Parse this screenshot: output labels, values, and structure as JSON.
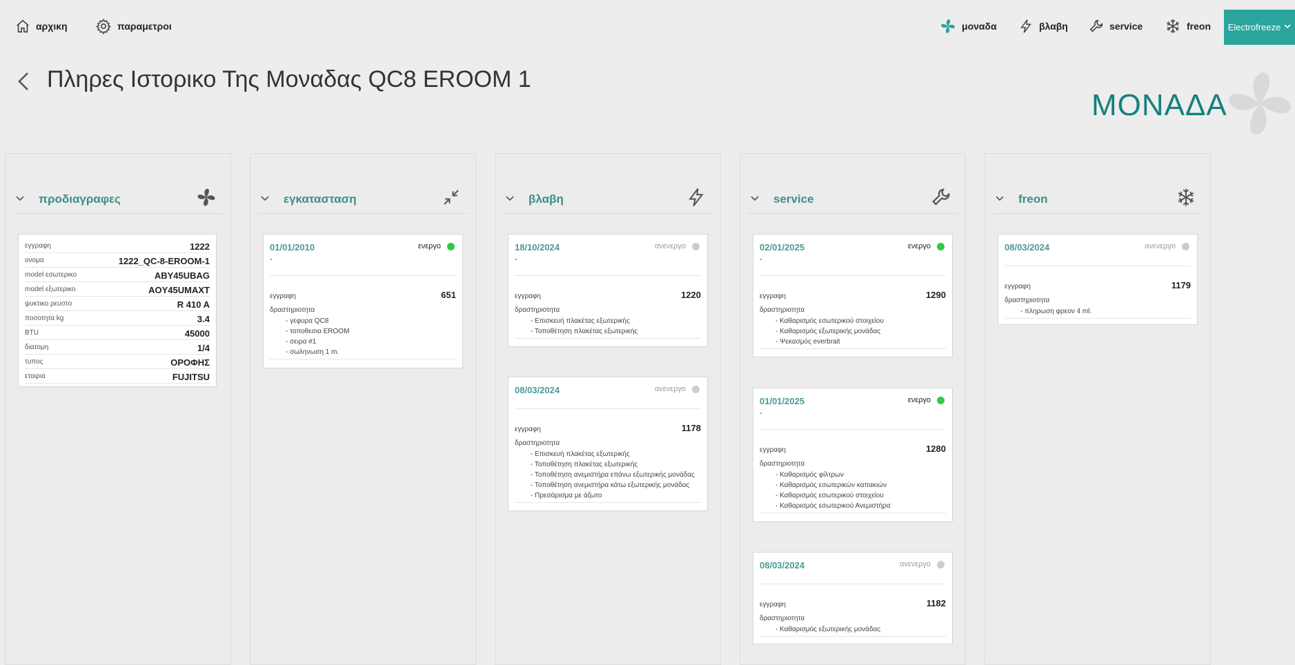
{
  "nav": {
    "home": "αρχικη",
    "settings": "παραμετροι",
    "unit": "μοναδα",
    "fault": "βλαβη",
    "service": "service",
    "freon": "freon",
    "company": "Electrofreeze"
  },
  "page": {
    "title": "Πληρες Ιστορικο Της Μοναδας QC8 EROOM 1",
    "section": "ΜΟΝΑΔΑ"
  },
  "colors": {
    "accent": "#2aa59d",
    "active": "#2ecc40",
    "inactive": "#cccccc"
  },
  "columns": {
    "specs": {
      "title": "προδιαγραφες",
      "rows": [
        {
          "k": "εγγραφη",
          "v": "1222"
        },
        {
          "k": "ονομα",
          "v": "1222_QC-8-EROOM-1"
        },
        {
          "k": "model εσωτερικο",
          "v": "ABY45UBAG"
        },
        {
          "k": "model εξωτερικο",
          "v": "AOY45UMAXT"
        },
        {
          "k": "ψυκτικο ρευστο",
          "v": "R 410 A"
        },
        {
          "k": "ποσοτητα kg",
          "v": "3.4"
        },
        {
          "k": "BTU",
          "v": "45000"
        },
        {
          "k": "διατομη",
          "v": "1/4"
        },
        {
          "k": "τυπος",
          "v": "ΟΡΟΦΗΣ"
        },
        {
          "k": "εταιρια",
          "v": "FUJITSU"
        }
      ]
    },
    "install": {
      "title": "εγκατασταση",
      "records": [
        {
          "date": "01/01/2010",
          "status": "ενεργο",
          "dash": "-",
          "record_label": "εγγραφη",
          "record": "651",
          "activity_label": "δραστηριοτητα",
          "activities": [
            "- γεφυρα QC8",
            "- τοποθεσια EROOM",
            "- σειρα #1",
            "- σωληνωση 1 m."
          ]
        }
      ]
    },
    "fault": {
      "title": "βλαβη",
      "records": [
        {
          "date": "18/10/2024",
          "status": "ανενεργο",
          "dash": "-",
          "record_label": "εγγραφη",
          "record": "1220",
          "activity_label": "δραστηριοτητα",
          "activities": [
            "- Επισκευή πλακέτας εξωτερικής",
            "- Τοποθέτηση πλακέτας εξωτερικής"
          ]
        },
        {
          "date": "08/03/2024",
          "status": "ανενεργο",
          "dash": "",
          "record_label": "εγγραφη",
          "record": "1178",
          "activity_label": "δραστηριοτητα",
          "activities": [
            "- Επισκευή πλακέτας εξωτερικής",
            "- Τοποθέτηση πλακέτας εξωτερικής",
            "- Τοποθέτηση ανεμιστήρα επάνω εξωτερικής μονάδας",
            "- Τοποθέτηση ανεμιστήρα κάτω εξωτερικής μονάδας",
            "- Πρεσάρισμα με άζωτο"
          ]
        }
      ]
    },
    "service": {
      "title": "service",
      "records": [
        {
          "date": "02/01/2025",
          "status": "ενεργο",
          "dash": "-",
          "record_label": "εγγραφη",
          "record": "1290",
          "activity_label": "δραστηριοτητα",
          "activities": [
            "- Καθαρισμός εσωτερικού στοιχείου",
            "- Καθαρισμός εξωτερικής μονάδας",
            "- Ψεκασμός everbrait"
          ]
        },
        {
          "date": "01/01/2025",
          "status": "ενεργο",
          "dash": "-",
          "record_label": "εγγραφη",
          "record": "1280",
          "activity_label": "δραστηριοτητα",
          "activities": [
            "- Καθαρισμός φίλτρων",
            "- Καθαρισμός εσωτερικών καπακιών",
            "- Καθαρισμός εσωτερικού στοιχείου",
            "- Καθαρισμός εσωτερικού Ανεμιστήρα"
          ]
        },
        {
          "date": "08/03/2024",
          "status": "ανενεργο",
          "dash": "",
          "record_label": "εγγραφη",
          "record": "1182",
          "activity_label": "δραστηριοτητα",
          "activities": [
            "- Καθαρισμός εξωτερικής μονάδας"
          ]
        }
      ]
    },
    "freon": {
      "title": "freon",
      "records": [
        {
          "date": "08/03/2024",
          "status": "ανενεργο",
          "dash": "",
          "record_label": "εγγραφη",
          "record": "1179",
          "activity_label": "δραστηριοτητα",
          "activities": [
            "- πληρωση φρεον 4 ml."
          ]
        }
      ]
    }
  }
}
